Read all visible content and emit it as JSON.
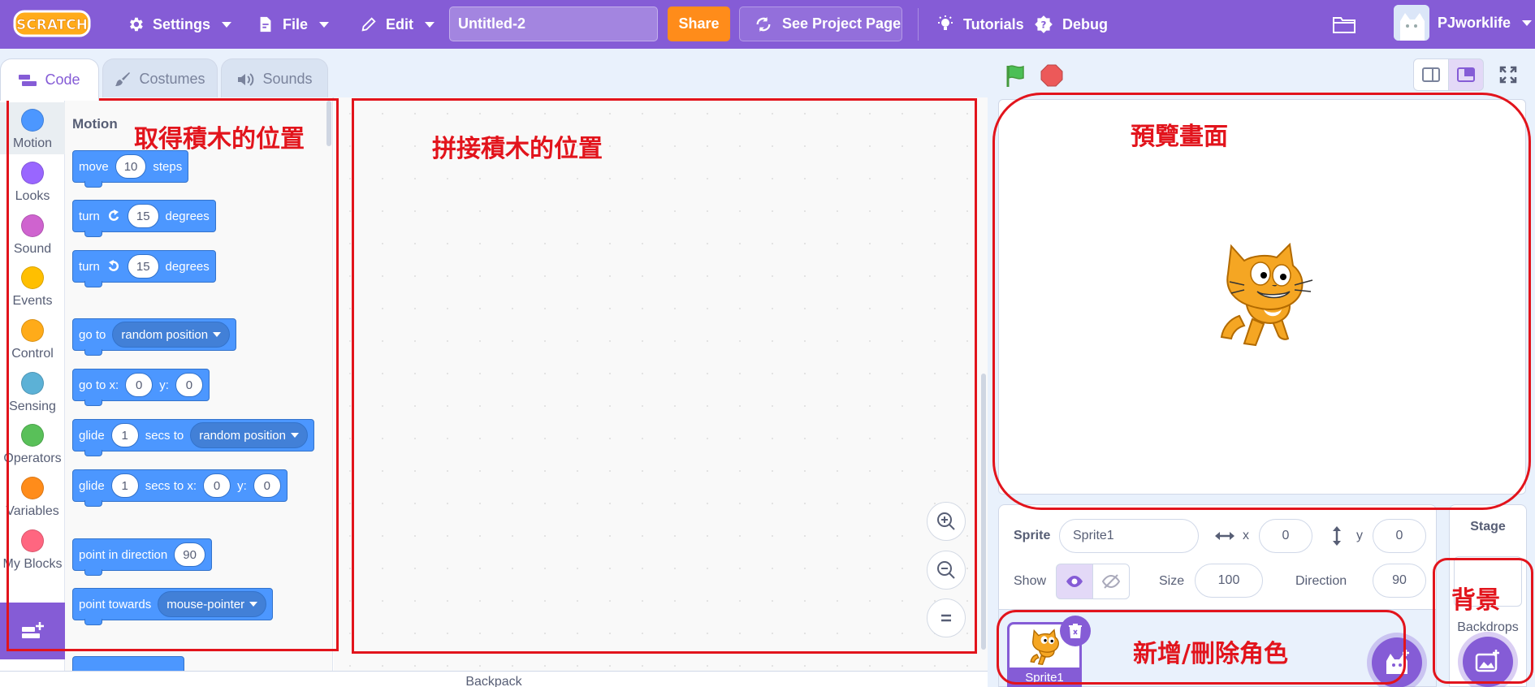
{
  "menubar": {
    "logo_text": "SCRATCH",
    "settings": "Settings",
    "file": "File",
    "edit": "Edit",
    "project_title": "Untitled-2",
    "share": "Share",
    "see_project_page": "See Project Page",
    "tutorials": "Tutorials",
    "debug": "Debug",
    "username": "PJworklife"
  },
  "tabs": [
    "Code",
    "Costumes",
    "Sounds"
  ],
  "categories": [
    {
      "label": "Motion",
      "color": "#4c97ff"
    },
    {
      "label": "Looks",
      "color": "#9966ff"
    },
    {
      "label": "Sound",
      "color": "#cf63cf"
    },
    {
      "label": "Events",
      "color": "#ffbf00"
    },
    {
      "label": "Control",
      "color": "#ffab19"
    },
    {
      "label": "Sensing",
      "color": "#5cb1d6"
    },
    {
      "label": "Operators",
      "color": "#59c059"
    },
    {
      "label": "Variables",
      "color": "#ff8c1a"
    },
    {
      "label": "My Blocks",
      "color": "#ff6680"
    }
  ],
  "flyout": {
    "title": "Motion",
    "blocks": {
      "move": {
        "pre": "move",
        "value": "10",
        "post": "steps"
      },
      "turn_right": {
        "pre": "turn",
        "value": "15",
        "post": "degrees"
      },
      "turn_left": {
        "pre": "turn",
        "value": "15",
        "post": "degrees"
      },
      "goto": {
        "pre": "go to",
        "option": "random position"
      },
      "goto_xy": {
        "pre": "go to x:",
        "x": "0",
        "mid": "y:",
        "y": "0"
      },
      "glide_to": {
        "pre": "glide",
        "value": "1",
        "mid": "secs to",
        "option": "random position"
      },
      "glide_xy": {
        "pre": "glide",
        "value": "1",
        "mid": "secs to x:",
        "x": "0",
        "mid2": "y:",
        "y": "0"
      },
      "point_dir": {
        "pre": "point in direction",
        "value": "90"
      },
      "point_towards": {
        "pre": "point towards",
        "option": "mouse-pointer"
      }
    }
  },
  "backpack": "Backpack",
  "sprite_info": {
    "sprite_label": "Sprite",
    "sprite_name": "Sprite1",
    "x_label": "x",
    "x_value": "0",
    "y_label": "y",
    "y_value": "0",
    "show_label": "Show",
    "size_label": "Size",
    "size_value": "100",
    "direction_label": "Direction",
    "direction_value": "90"
  },
  "sprite_list": {
    "thumb_name": "Sprite1"
  },
  "stage_pane": {
    "title": "Stage",
    "backdrops": "Backdrops"
  },
  "annotations": {
    "blocks_palette": "取得積木的位置",
    "workspace": "拼接積木的位置",
    "stage": "預覽畫面",
    "backdrop": "背景",
    "sprites": "新增/刪除角色"
  },
  "colors": {
    "accent": "#855cd6",
    "motion": "#4c97ff",
    "share": "#ff8c1a",
    "annotation": "#e2141c"
  }
}
